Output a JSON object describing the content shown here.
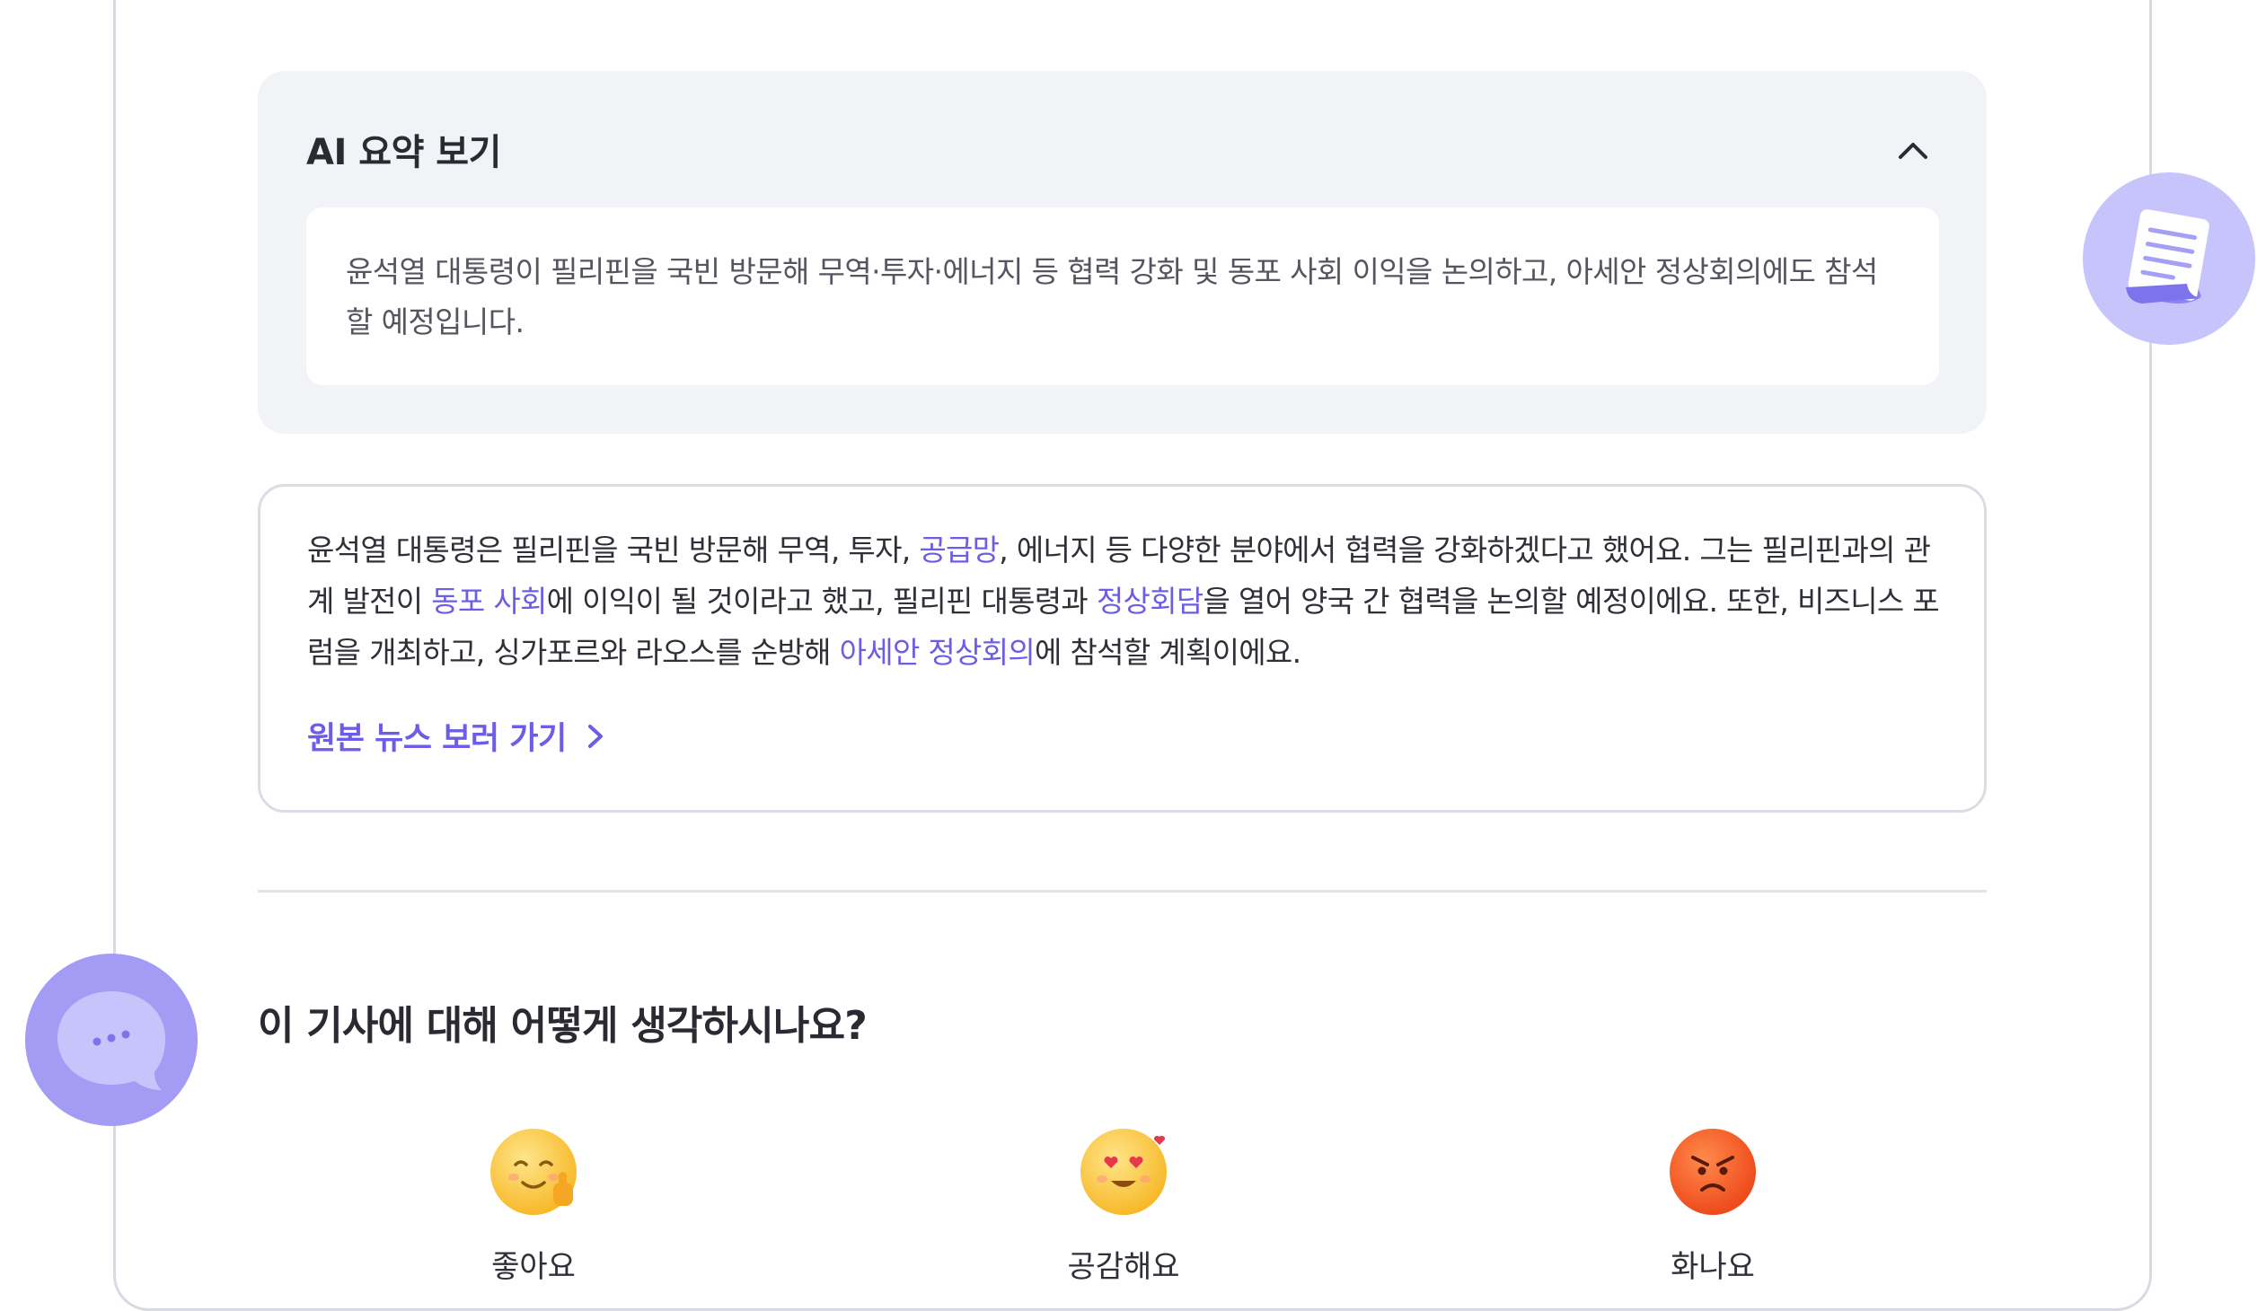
{
  "summary": {
    "title": "AI 요약 보기",
    "text": "윤석열 대통령이 필리핀을 국빈 방문해 무역·투자·에너지 등 협력 강화 및 동포 사회 이익을 논의하고, 아세안 정상회의에도 참석할 예정입니다."
  },
  "article": {
    "segments": [
      {
        "text": "윤석열 대통령은 필리핀을 국빈 방문해 무역, 투자, ",
        "highlight": false
      },
      {
        "text": "공급망",
        "highlight": true
      },
      {
        "text": ", 에너지 등 다양한 분야에서 협력을 강화하겠다고 했어요. 그는 필리핀과의 관계 발전이 ",
        "highlight": false
      },
      {
        "text": "동포 사회",
        "highlight": true
      },
      {
        "text": "에 이익이 될 것이라고 했고, 필리핀 대통령과 ",
        "highlight": false
      },
      {
        "text": "정상회담",
        "highlight": true
      },
      {
        "text": "을 열어 양국 간 협력을 논의할 예정이에요. 또한, 비즈니스 포럼을 개최하고, 싱가포르와 라오스를 순방해 ",
        "highlight": false
      },
      {
        "text": "아세안 정상회의",
        "highlight": true
      },
      {
        "text": "에 참석할 계획이에요.",
        "highlight": false
      }
    ],
    "source_link": "원본 뉴스 보러 가기"
  },
  "feedback": {
    "question": "이 기사에 대해 어떻게 생각하시나요?",
    "reactions": [
      {
        "label": "좋아요",
        "icon": "smile-thumbs-up-icon"
      },
      {
        "label": "공감해요",
        "icon": "heart-eyes-icon"
      },
      {
        "label": "화나요",
        "icon": "angry-face-icon"
      }
    ]
  },
  "colors": {
    "accent": "#6c5ce7",
    "summary_bg": "#f2f3f6",
    "deco_bubble": "#c7c4fb"
  }
}
